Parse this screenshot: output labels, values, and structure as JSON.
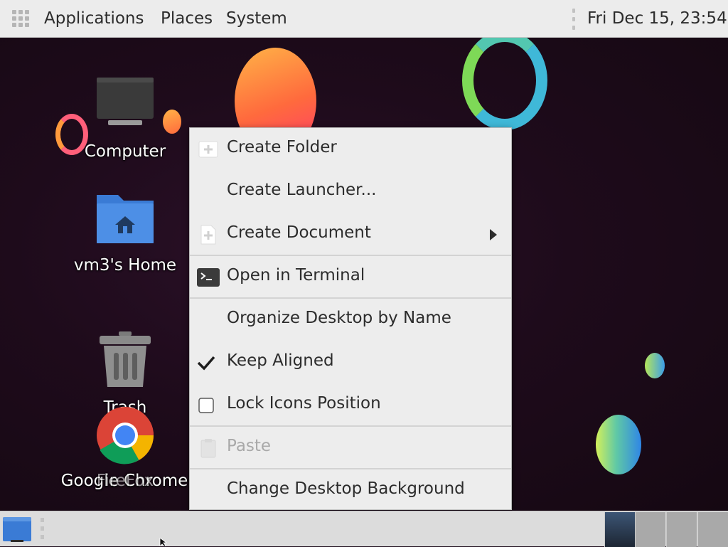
{
  "top_panel": {
    "menus": [
      "Applications",
      "Places",
      "System"
    ],
    "clock": "Fri Dec 15, 23:54"
  },
  "desktop_icons": {
    "computer": "Computer",
    "home": "vm3's Home",
    "trash": "Trash",
    "chrome_overlap_a": "Google Chrome",
    "chrome_overlap_b": "FireFox"
  },
  "context_menu": {
    "items": [
      {
        "label": "Create Folder",
        "icon": "folder-plus-icon"
      },
      {
        "label": "Create Launcher...",
        "icon": ""
      },
      {
        "label": "Create Document",
        "icon": "document-plus-icon",
        "submenu": true
      },
      {
        "label": "Open in Terminal",
        "icon": "terminal-icon"
      },
      {
        "label": "Organize Desktop by Name",
        "icon": ""
      },
      {
        "label": "Keep Aligned",
        "icon": "checkmark-icon",
        "checked": true
      },
      {
        "label": "Lock Icons Position",
        "icon": "checkbox-icon",
        "checked": false
      },
      {
        "label": "Paste",
        "icon": "clipboard-icon",
        "disabled": true
      },
      {
        "label": "Change Desktop Background",
        "icon": ""
      }
    ]
  },
  "colors": {
    "panel": "#ececec",
    "desktop": "#1e0b1b",
    "menu": "#ededed",
    "taskbar_active": "#3c5575"
  }
}
